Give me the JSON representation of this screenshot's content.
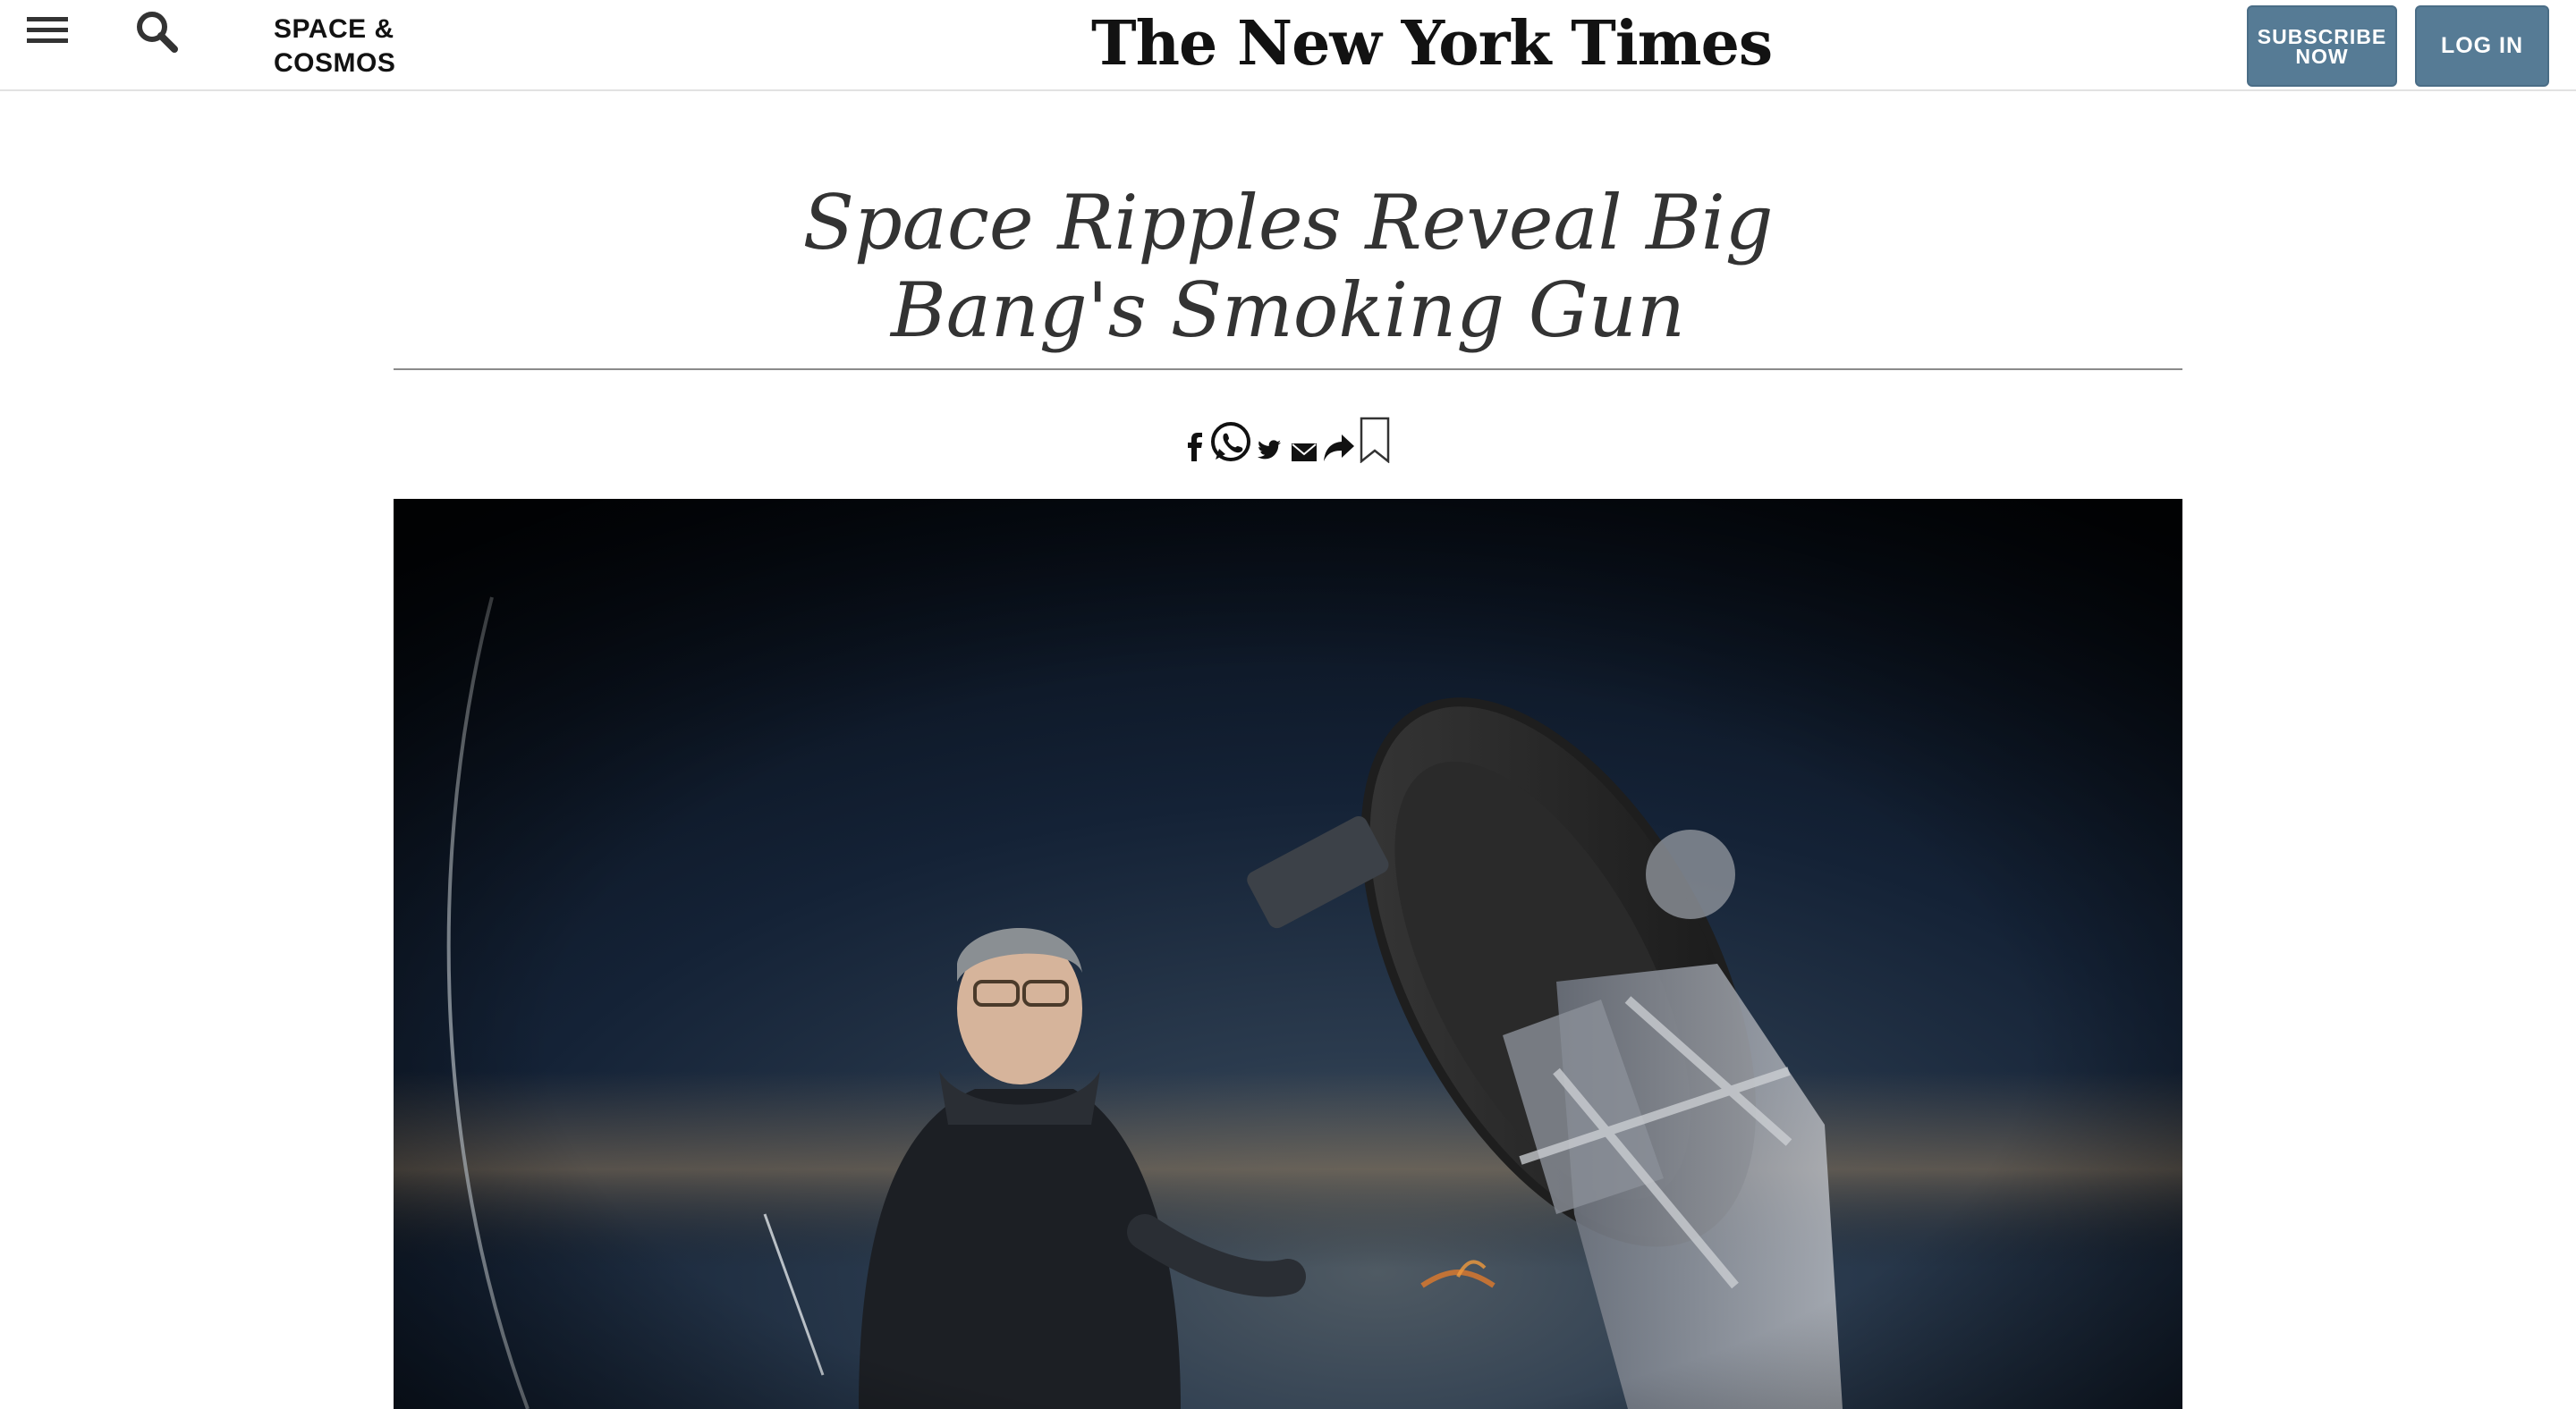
{
  "header": {
    "section": "SPACE & COSMOS",
    "section_line1": "SPACE &",
    "section_line2": "COSMOS",
    "masthead": "The New York Times",
    "subscribe_line1": "SUBSCRIBE",
    "subscribe_line2": "NOW",
    "login": "LOG IN",
    "icons": [
      "menu-icon",
      "search-icon"
    ]
  },
  "article": {
    "headline_line1": "Space Ripples Reveal Big",
    "headline_line2": "Bang's Smoking Gun"
  },
  "share": {
    "icons": [
      "facebook-icon",
      "whatsapp-icon",
      "twitter-icon",
      "email-icon",
      "share-icon",
      "bookmark-icon"
    ]
  },
  "colors": {
    "button_bg": "#567b95",
    "text": "#121212",
    "headline": "#333333",
    "rule": "#8a8a8a"
  }
}
